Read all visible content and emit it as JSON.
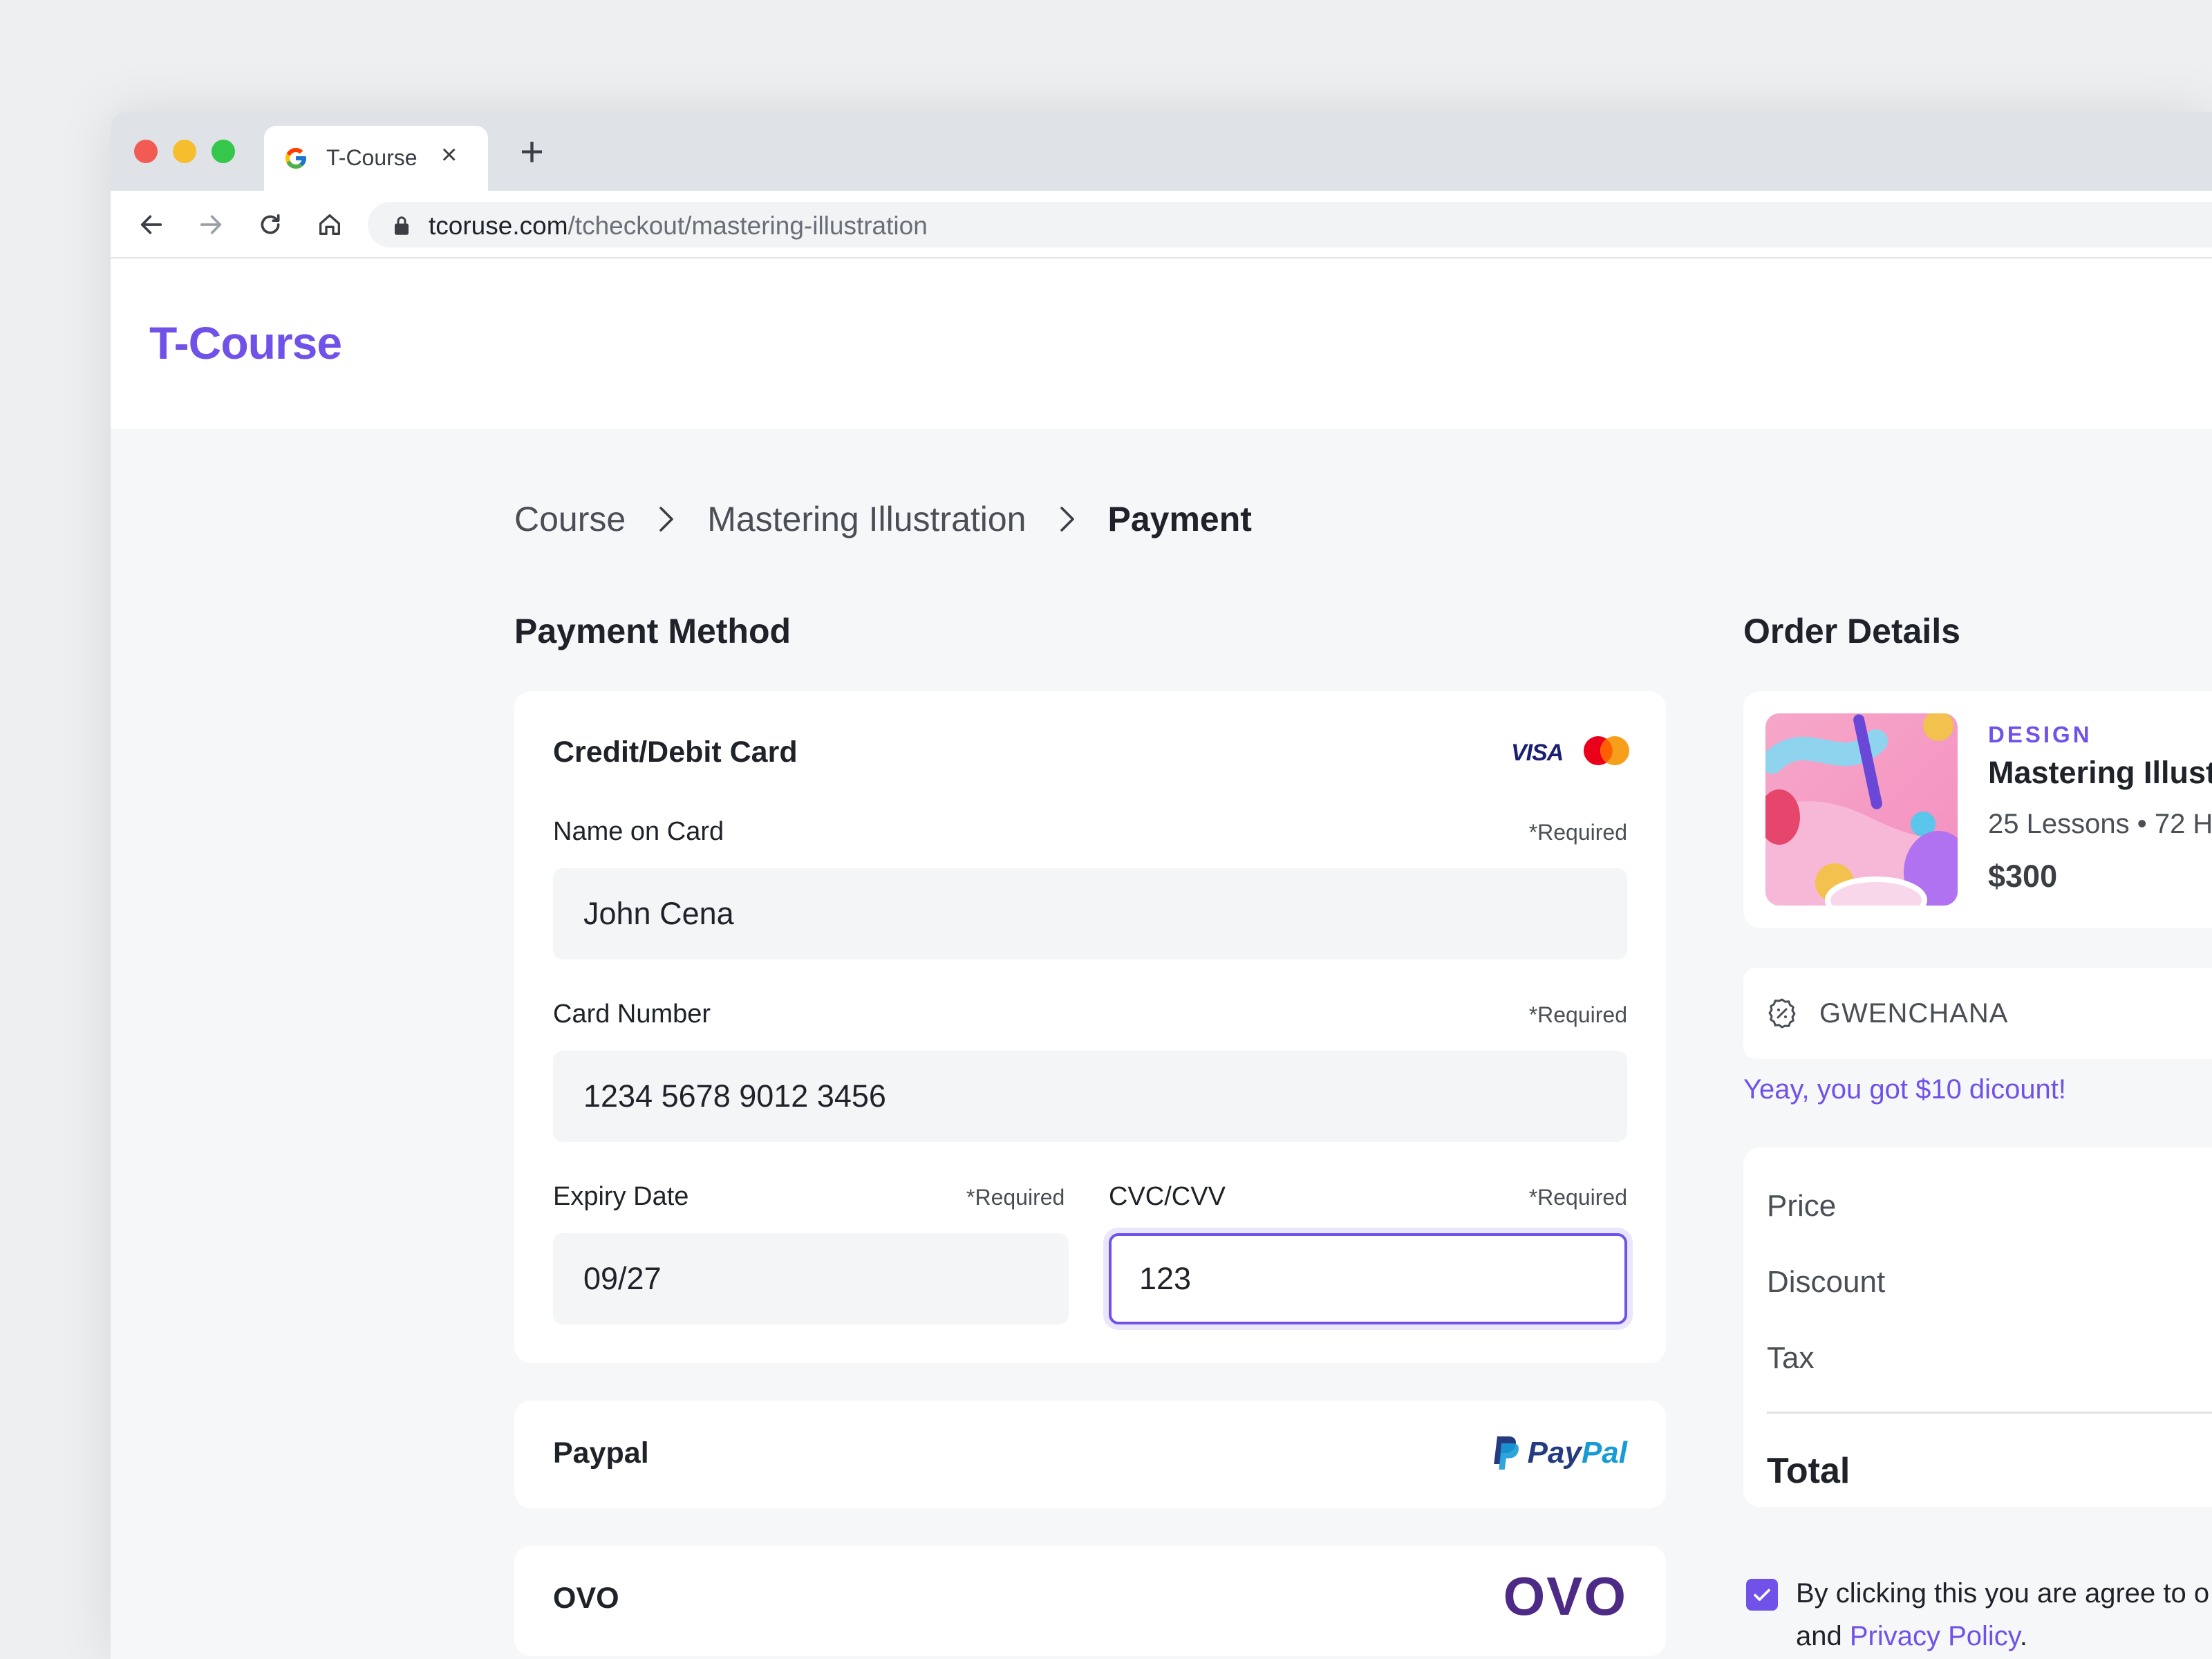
{
  "browser": {
    "tab_title": "T-Course",
    "tab_close": "×",
    "new_tab": "+",
    "url_domain": "tcoruse.com",
    "url_path": "/tcheckout/mastering-illustration"
  },
  "site": {
    "logo": "T-Course"
  },
  "breadcrumb": {
    "items": [
      "Course",
      "Mastering Illustration",
      "Payment"
    ]
  },
  "payment": {
    "section_title": "Payment Method",
    "card": {
      "title": "Credit/Debit Card",
      "visa_label": "VISA",
      "name_label": "Name on Card",
      "name_value": "John Cena",
      "number_label": "Card Number",
      "number_value": "1234 5678 9012 3456",
      "expiry_label": "Expiry Date",
      "expiry_value": "09/27",
      "cvc_label": "CVC/CVV",
      "cvc_value": "123",
      "required_text": "*Required"
    },
    "paypal": {
      "title": "Paypal",
      "logo_pay": "Pay",
      "logo_pal": "Pal"
    },
    "ovo": {
      "title": "OVO",
      "logo": "OVO"
    }
  },
  "order": {
    "section_title": "Order Details",
    "course": {
      "category": "DESIGN",
      "title": "Mastering Illust",
      "meta": "25 Lessons • 72 H",
      "price": "$300"
    },
    "coupon": {
      "code": "GWENCHANA",
      "message": "Yeay, you got $10 dicount!"
    },
    "summary": {
      "price_label": "Price",
      "discount_label": "Discount",
      "tax_label": "Tax",
      "total_label": "Total"
    },
    "agreement": {
      "line1": "By clicking this you are agree to o",
      "line2_prefix": "and ",
      "link": "Privacy Policy",
      "line2_suffix": "."
    }
  },
  "colors": {
    "accent": "#7152e8",
    "traffic_red": "#f25b54",
    "traffic_yellow": "#f6be2f",
    "traffic_green": "#35c74a"
  }
}
